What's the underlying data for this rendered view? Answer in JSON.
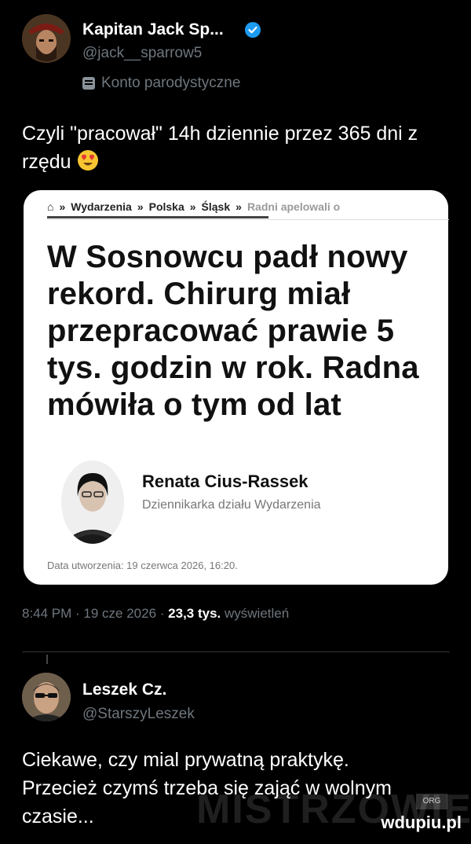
{
  "tweet1": {
    "name": "Kapitan Jack Sp...",
    "handle": "@jack__sparrow5",
    "label": "Konto parodystyczne",
    "text_line1": "Czyli \"pracował\" 14h dziennie przez 365 dni z",
    "text_line2": "rzędu",
    "card": {
      "breadcrumb": {
        "home": "⌂",
        "sep": "»",
        "items": [
          "Wydarzenia",
          "Polska",
          "Śląsk"
        ],
        "current": "Radni apelowali o"
      },
      "headline_lines": [
        "W Sosnowcu padł nowy",
        "rekord. Chirurg miał",
        "przepracować prawie 5",
        "tys. godzin w rok. Radna",
        "mówiła o tym od lat"
      ],
      "author_name": "Renata Cius-Rassek",
      "author_role": "Dziennikarka działu Wydarzenia",
      "created": "Data utworzenia: 19 czerwca 2026, 16:20."
    },
    "meta": {
      "time": "8:44 PM · 19 cze 2026 · ",
      "views": "23,3 tys.",
      "views_label": " wyświetleń"
    }
  },
  "tweet2": {
    "name": "Leszek Cz.",
    "handle": "@StarszyLeszek",
    "text_lines": [
      "Ciekawe, czy mial prywatną praktykę.",
      "Przecież czymś trzeba się zająć w wolnym",
      "czasie..."
    ]
  },
  "watermark": "MISTRZOWIE",
  "watermark_org": "ORG",
  "site": "wdupiu.pl",
  "colors": {
    "verified": "#1d9bf0",
    "muted": "#6e767d"
  }
}
